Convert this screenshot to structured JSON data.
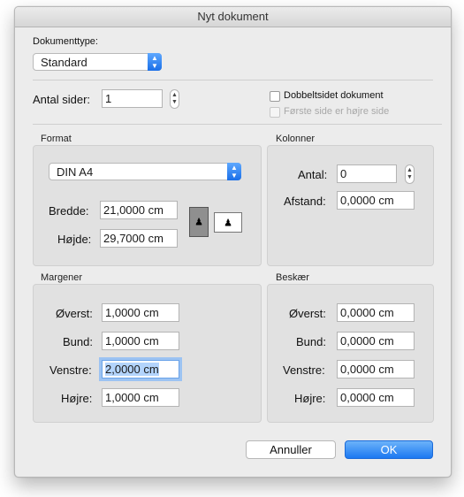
{
  "window": {
    "title": "Nyt dokument"
  },
  "doctype": {
    "label": "Dokumenttype:",
    "value": "Standard"
  },
  "pages": {
    "label": "Antal sider:",
    "value": "1"
  },
  "options": {
    "double_sided": "Dobbeltsidet dokument",
    "first_right": "Første side er højre side"
  },
  "format": {
    "title": "Format",
    "size": "DIN A4",
    "width_label": "Bredde:",
    "width_value": "21,0000 cm",
    "height_label": "Højde:",
    "height_value": "29,7000 cm",
    "orientation_selected": "portrait"
  },
  "columns": {
    "title": "Kolonner",
    "count_label": "Antal:",
    "count_value": "0",
    "gap_label": "Afstand:",
    "gap_value": "0,0000 cm"
  },
  "margins": {
    "title": "Margener",
    "top_label": "Øverst:",
    "top_value": "1,0000 cm",
    "bottom_label": "Bund:",
    "bottom_value": "1,0000 cm",
    "left_label": "Venstre:",
    "left_value": "2,0000 cm",
    "right_label": "Højre:",
    "right_value": "1,0000 cm"
  },
  "crop": {
    "title": "Beskær",
    "top_label": "Øverst:",
    "top_value": "0,0000 cm",
    "bottom_label": "Bund:",
    "bottom_value": "0,0000 cm",
    "left_label": "Venstre:",
    "left_value": "0,0000 cm",
    "right_label": "Højre:",
    "right_value": "0,0000 cm"
  },
  "buttons": {
    "cancel": "Annuller",
    "ok": "OK"
  },
  "colors": {
    "accent": "#1c78f1",
    "focus": "#9cc3f2"
  }
}
